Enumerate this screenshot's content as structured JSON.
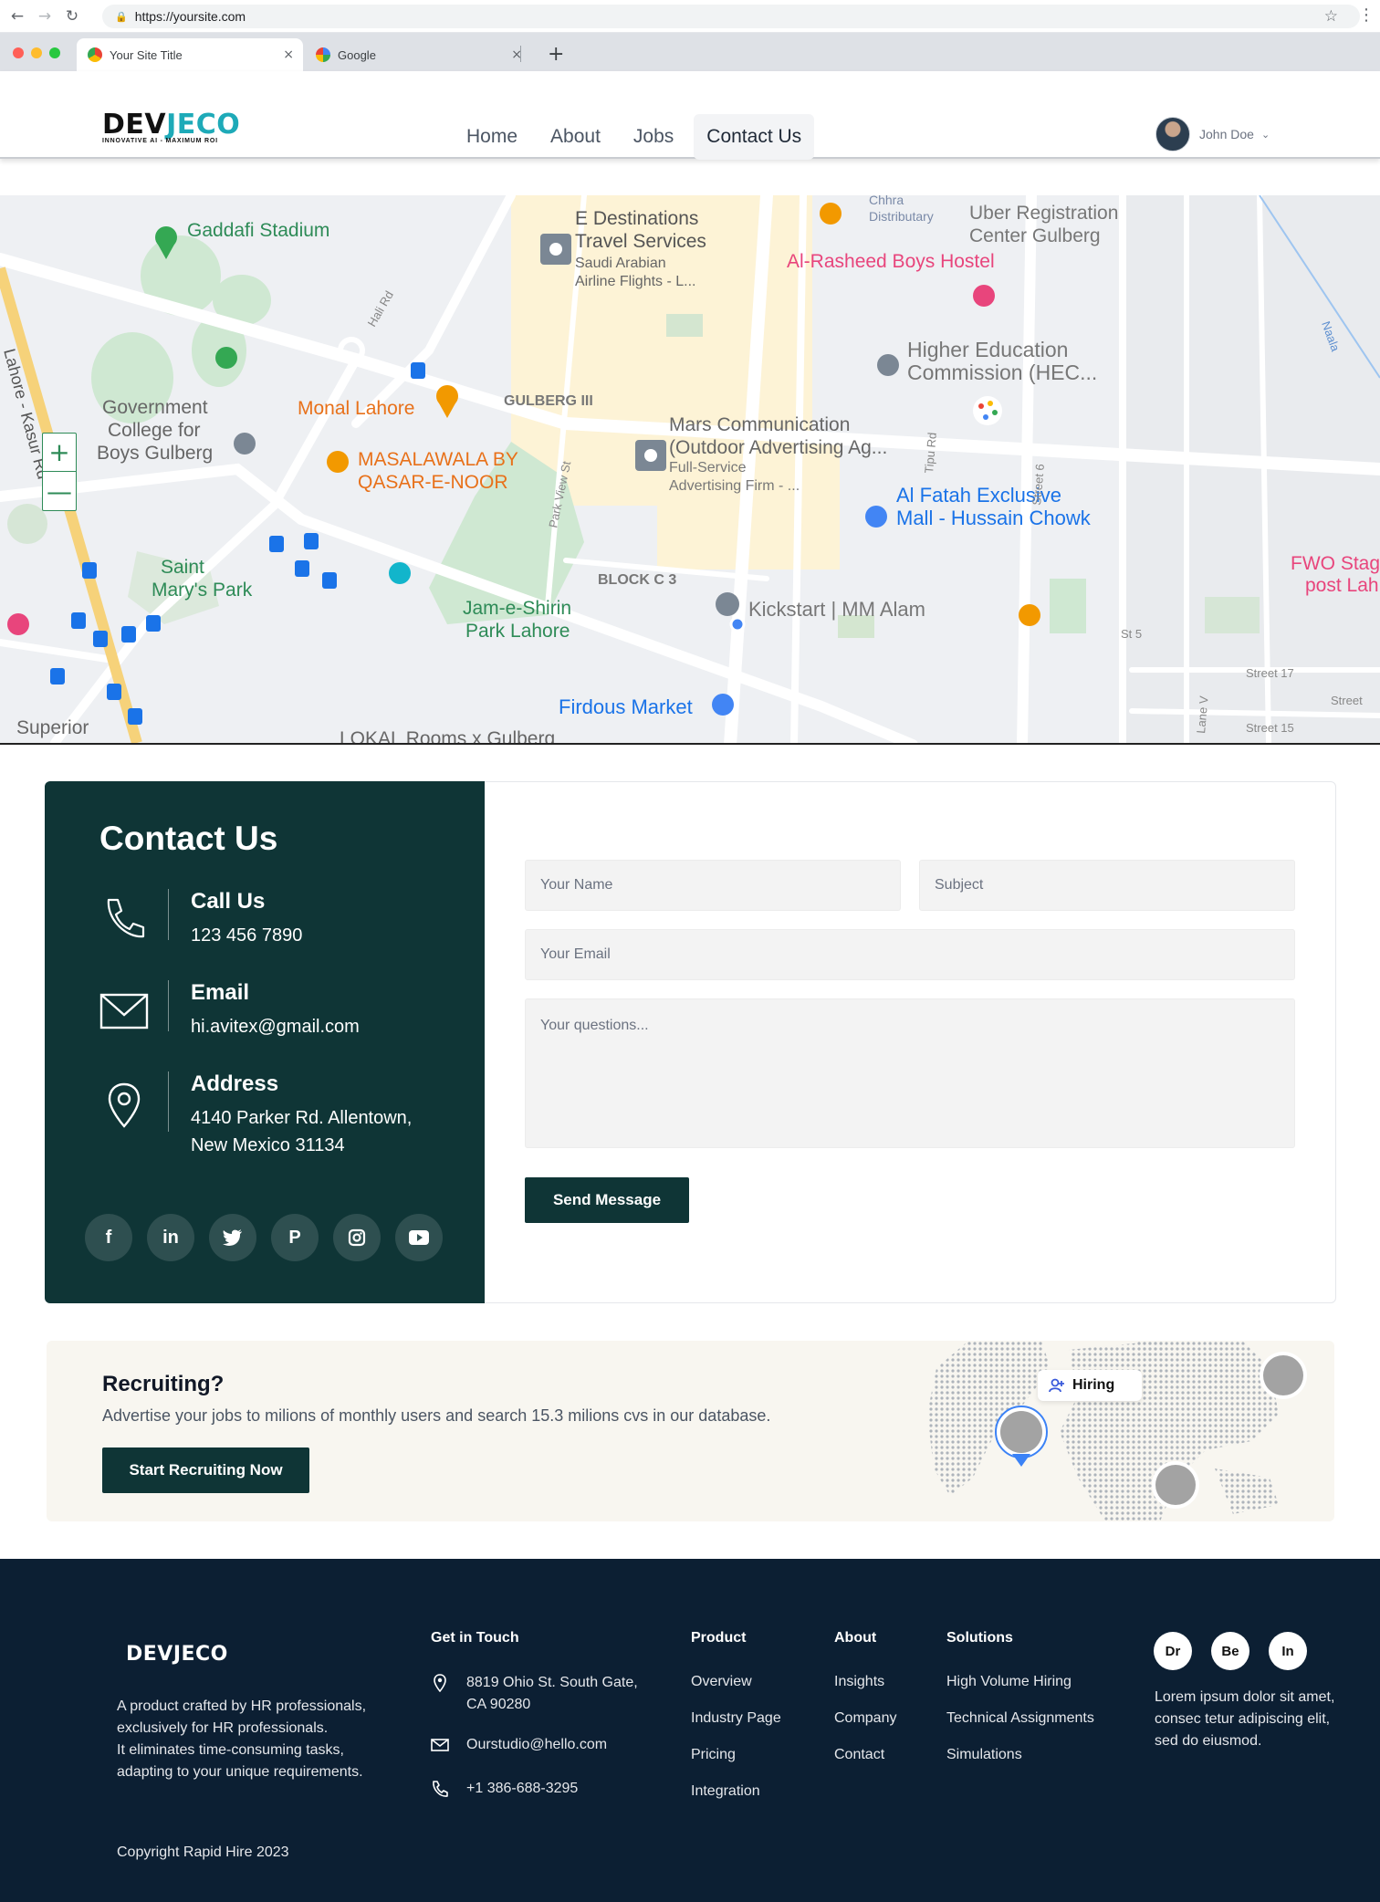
{
  "browser": {
    "url": "https://yoursite.com",
    "tabs": [
      {
        "title": "Your Site Title"
      },
      {
        "title": "Google"
      }
    ]
  },
  "header": {
    "logo": {
      "text_main": "DEV",
      "text_accent": "JECO",
      "tagline": "INNOVATIVE AI - MAXIMUM ROI"
    },
    "nav": [
      "Home",
      "About",
      "Jobs",
      "Contact Us"
    ],
    "active_nav": "Contact Us",
    "user": {
      "name": "John Doe"
    }
  },
  "map": {
    "zoom_in": "+",
    "zoom_out": "—",
    "labels": [
      "Gaddafi Stadium",
      "E Destinations Travel Services",
      "Saudi Arabian Airline Flights - L...",
      "Uber Registration Center Gulberg",
      "Al-Rasheed Boys Hostel",
      "Chhra Distributary",
      "Government College for Boys Gulberg",
      "Monal Lahore",
      "GULBERG III",
      "Higher Education Commission (HEC...",
      "Mars Communication (Outdoor Advertising Ag...",
      "Full-Service Advertising Firm - ...",
      "MASALAWALA BY QASAR-E-NOOR",
      "Al Fatah Exclusive Mall - Hussain Chowk",
      "Saint Mary's Park",
      "BLOCK C 3",
      "Kickstart | MM Alam",
      "FWO Stag post Lah",
      "Jam-e-Shirin Park Lahore",
      "Firdous Market",
      "Superior",
      "LOKAL Rooms x Gulberg",
      "Lahore - Kasur Rd",
      "Hali Rd",
      "Park View St",
      "Tipu Rd",
      "Street 6",
      "St 5",
      "Street 17",
      "Street 15",
      "Lane V",
      "Naala"
    ]
  },
  "contact": {
    "title": "Contact Us",
    "items": [
      {
        "icon": "phone-icon",
        "label": "Call Us",
        "value": "123 456 7890"
      },
      {
        "icon": "mail-icon",
        "label": "Email",
        "value": "hi.avitex@gmail.com"
      },
      {
        "icon": "location-pin-icon",
        "label": "Address",
        "value_line1": "4140 Parker Rd. Allentown,",
        "value_line2": "New Mexico 31134"
      }
    ],
    "socials": [
      {
        "icon": "facebook-icon",
        "glyph": "f"
      },
      {
        "icon": "linkedin-icon",
        "glyph": "in"
      },
      {
        "icon": "twitter-icon",
        "glyph": "t"
      },
      {
        "icon": "pinterest-icon",
        "glyph": "P"
      },
      {
        "icon": "instagram-icon",
        "glyph": "◎"
      },
      {
        "icon": "youtube-icon",
        "glyph": "▶"
      }
    ],
    "form": {
      "name_placeholder": "Your Name",
      "subject_placeholder": "Subject",
      "email_placeholder": "Your Email",
      "questions_placeholder": "Your questions...",
      "submit_label": "Send Message"
    }
  },
  "recruit": {
    "title": "Recruiting?",
    "text": "Advertise  your jobs to milions of monthly users and search 15.3 milions cvs in our database.",
    "button": "Start Recruiting Now",
    "badge": "Hiring"
  },
  "footer": {
    "logo": "DEVJECO",
    "description_lines": [
      "A product crafted by HR professionals,",
      "exclusively for HR professionals.",
      "It eliminates time-consuming tasks,",
      "adapting to your unique requirements."
    ],
    "copyright": "Copyright Rapid Hire 2023",
    "get_in_touch": {
      "heading": "Get in Touch",
      "address_line1": "8819 Ohio St. South Gate,",
      "address_line2": "CA 90280",
      "email": "Ourstudio@hello.com",
      "phone": "+1 386-688-3295"
    },
    "product": {
      "heading": "Product",
      "links": [
        "Overview",
        "Industry Page",
        "Pricing",
        "Integration"
      ]
    },
    "about": {
      "heading": "About",
      "links": [
        "Insights",
        "Company",
        "Contact"
      ]
    },
    "solutions": {
      "heading": "Solutions",
      "links": [
        "High Volume Hiring",
        "Technical Assignments",
        "Simulations"
      ]
    },
    "badges": [
      "Dr",
      "Be",
      "In"
    ],
    "lorem_lines": [
      "Lorem ipsum dolor sit amet,",
      "consec tetur adipiscing elit,",
      "sed do eiusmod."
    ]
  },
  "colors": {
    "brand_dark": "#0f3536",
    "accent": "#1eaab8",
    "footer_bg": "#0c1f33",
    "banner_bg": "#f8f6f0"
  }
}
